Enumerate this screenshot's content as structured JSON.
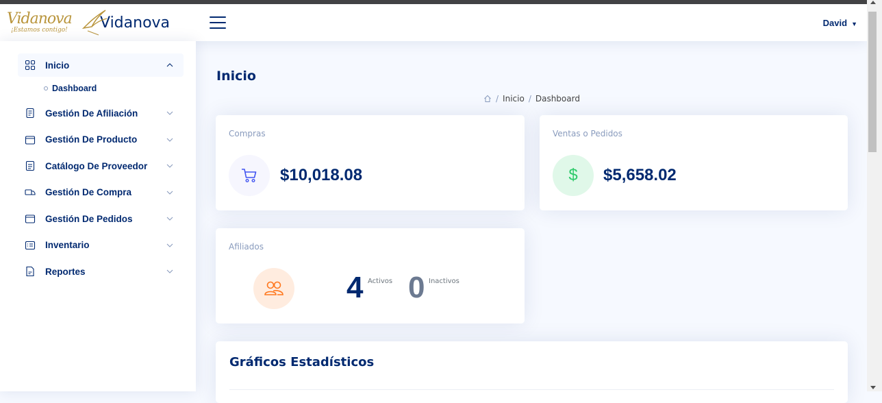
{
  "header": {
    "logo_script": "Vidanova",
    "logo_tagline": "¡Estamos contigo!",
    "brand": "Vidanova",
    "user_name": "David"
  },
  "sidebar": {
    "items": [
      {
        "label": "Inicio",
        "icon": "grid-icon",
        "expanded": true
      },
      {
        "label": "Gestión De Afiliación",
        "icon": "journal-text-icon"
      },
      {
        "label": "Gestión De Producto",
        "icon": "box-icon"
      },
      {
        "label": "Catálogo De Proveedor",
        "icon": "file-text-icon"
      },
      {
        "label": "Gestión De Compra",
        "icon": "truck-icon"
      },
      {
        "label": "Gestión De Pedidos",
        "icon": "box-icon"
      },
      {
        "label": "Inventario",
        "icon": "list-icon"
      },
      {
        "label": "Reportes",
        "icon": "file-icon"
      }
    ],
    "sub_items": [
      {
        "label": "Dashboard"
      }
    ]
  },
  "main": {
    "page_title": "Inicio",
    "breadcrumb": [
      "Inicio",
      "Dashboard"
    ],
    "compras": {
      "label": "Compras",
      "amount": "$10,018.08",
      "icon": "cart-icon"
    },
    "ventas": {
      "label": "Ventas o Pedidos",
      "amount": "$5,658.02",
      "icon": "dollar-icon"
    },
    "afiliados": {
      "label": "Afiliados",
      "activos_count": "4",
      "activos_label": "Activos",
      "inactivos_count": "0",
      "inactivos_label": "Inactivos",
      "icon": "people-icon"
    },
    "stats_title": "Gráficos Estadísticos"
  },
  "colors": {
    "primary": "#012970",
    "muted": "#899bbd",
    "gold": "#b9953c",
    "green": "#2eca6a",
    "orange": "#ff771d"
  }
}
